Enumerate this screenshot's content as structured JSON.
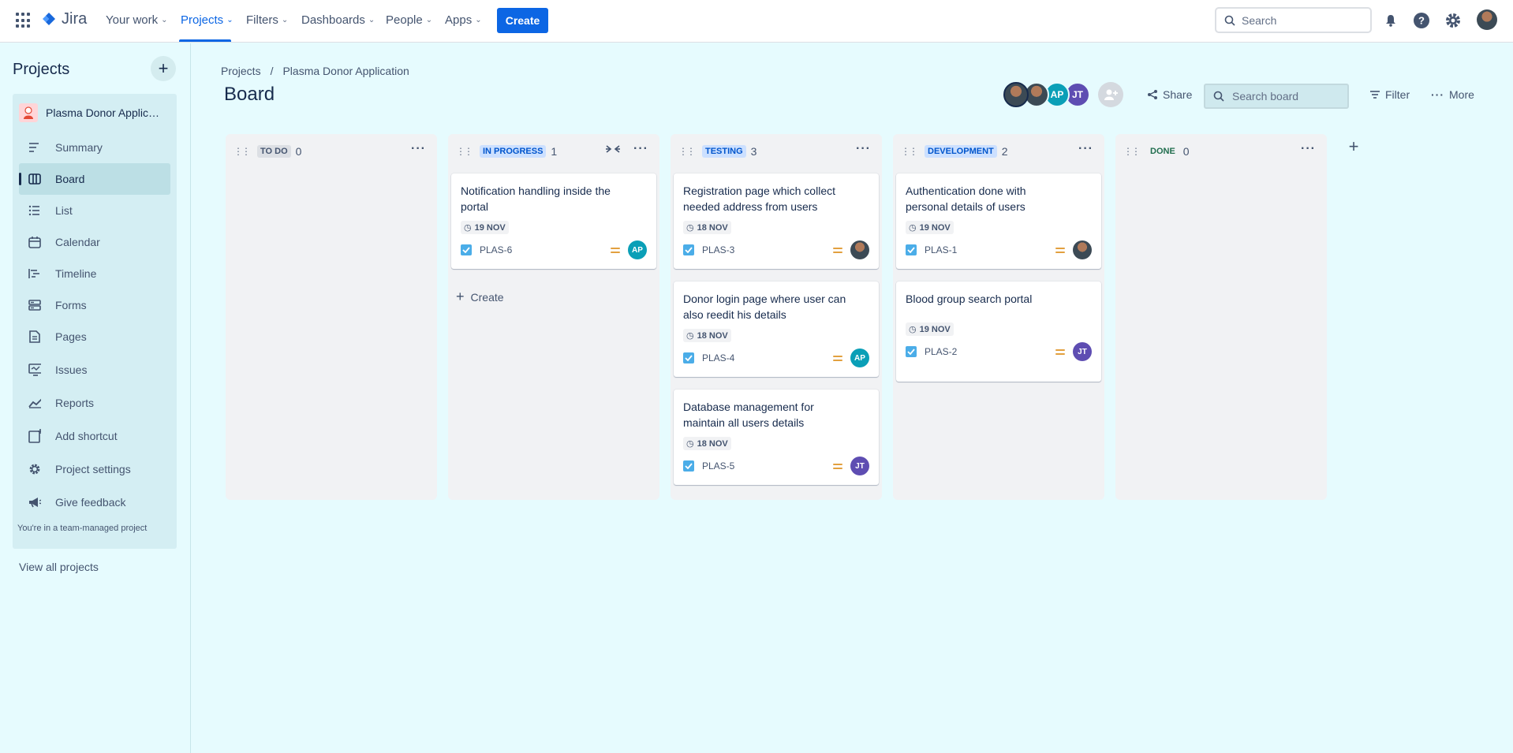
{
  "nav": {
    "logo": "Jira",
    "items": [
      "Your work",
      "Projects",
      "Filters",
      "Dashboards",
      "People",
      "Apps"
    ],
    "create_label": "Create",
    "search_placeholder": "Search"
  },
  "sidebar": {
    "title": "Projects",
    "project_name": "Plasma Donor Application",
    "items": [
      "Summary",
      "Board",
      "List",
      "Calendar",
      "Timeline",
      "Forms",
      "Pages",
      "Issues",
      "Reports",
      "Add shortcut",
      "Project settings",
      "Give feedback"
    ],
    "footer": "You're in a team-managed project",
    "view_all": "View all projects"
  },
  "breadcrumb": [
    "Projects",
    "/",
    "Plasma Donor Application"
  ],
  "page_title": "Board",
  "toolbar": {
    "avatars": [
      "",
      "",
      "AP",
      "JT"
    ],
    "share": "Share",
    "search_placeholder": "Search board",
    "filter": "Filter",
    "more": "More"
  },
  "columns": [
    {
      "label": "TO DO",
      "count": "0",
      "cards": []
    },
    {
      "label": "IN PROGRESS",
      "count": "1",
      "create": "Create",
      "cards": [
        {
          "title": "Notification handling inside the portal",
          "date": "19 NOV",
          "key": "PLAS-6",
          "assignee": "AP"
        }
      ]
    },
    {
      "label": "TESTING",
      "count": "3",
      "cards": [
        {
          "title": "Registration page which collect needed address from users",
          "date": "18 NOV",
          "key": "PLAS-3",
          "assignee": ""
        },
        {
          "title": "Donor login page where user can also reedit his details",
          "date": "18 NOV",
          "key": "PLAS-4",
          "assignee": "AP"
        },
        {
          "title": "Database management for maintain all users details",
          "date": "18 NOV",
          "key": "PLAS-5",
          "assignee": "JT"
        }
      ]
    },
    {
      "label": "DEVELOPMENT",
      "count": "2",
      "cards": [
        {
          "title": "Authentication done with personal details of users",
          "date": "19 NOV",
          "key": "PLAS-1",
          "assignee": ""
        },
        {
          "title": "Blood group search portal",
          "date": "19 NOV",
          "key": "PLAS-2",
          "assignee": "JT"
        }
      ]
    },
    {
      "label": "DONE",
      "count": "0",
      "cards": []
    }
  ],
  "colors": {
    "accent": "#0c66e4",
    "ap": "#0a9fb7",
    "jt": "#5e4db2",
    "priority": "#e2a03f"
  }
}
